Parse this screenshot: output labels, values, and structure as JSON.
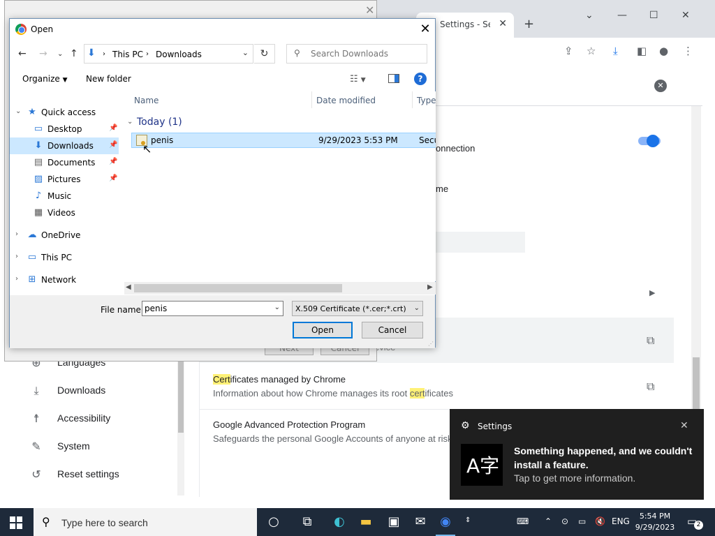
{
  "chrome": {
    "tab_title": "Settings - Sec",
    "rows": {
      "row1_tail": "onnection",
      "row2_tail": "me",
      "wizard_device": "evice",
      "cert_title_hl": "Cert",
      "cert_title_rest": "ificates managed by Chrome",
      "cert_sub_pre": "Information about how Chrome manages its root ",
      "cert_sub_hl": "cert",
      "cert_sub_post": "ificates",
      "gapp_title": "Google Advanced Protection Program",
      "gapp_sub": "Safeguards the personal Google Accounts of anyone at risk"
    },
    "sidebar": [
      {
        "label": "Languages",
        "icon": "globe-icon"
      },
      {
        "label": "Downloads",
        "icon": "download-icon"
      },
      {
        "label": "Accessibility",
        "icon": "accessibility-icon"
      },
      {
        "label": "System",
        "icon": "wrench-icon"
      },
      {
        "label": "Reset settings",
        "icon": "reset-icon"
      }
    ]
  },
  "wizard": {
    "next_label": "Next",
    "cancel_label": "Cancel"
  },
  "dialog": {
    "title": "Open",
    "breadcrumbs": [
      "This PC",
      "Downloads"
    ],
    "search_placeholder": "Search Downloads",
    "organize_label": "Organize",
    "new_folder_label": "New folder",
    "nav_items": [
      {
        "label": "Quick access",
        "icon": "star-icon",
        "pinned": false
      },
      {
        "label": "Desktop",
        "icon": "desktop-icon",
        "pinned": true
      },
      {
        "label": "Downloads",
        "icon": "download-icon",
        "pinned": true,
        "selected": true
      },
      {
        "label": "Documents",
        "icon": "document-icon",
        "pinned": true
      },
      {
        "label": "Pictures",
        "icon": "picture-icon",
        "pinned": true
      },
      {
        "label": "Music",
        "icon": "music-icon",
        "pinned": false
      },
      {
        "label": "Videos",
        "icon": "video-icon",
        "pinned": false
      },
      {
        "label": "OneDrive",
        "icon": "cloud-icon",
        "pinned": false
      },
      {
        "label": "This PC",
        "icon": "computer-icon",
        "pinned": false
      },
      {
        "label": "Network",
        "icon": "network-icon",
        "pinned": false
      }
    ],
    "columns": [
      "Name",
      "Date modified",
      "Type"
    ],
    "group_header": "Today (1)",
    "file": {
      "name": "penis",
      "date_modified": "9/29/2023 5:53 PM",
      "type": "Secu"
    },
    "file_name_label": "File name:",
    "file_name_value": "penis",
    "file_type_selected": "X.509 Certificate (*.cer;*.crt)",
    "open_label": "Open",
    "cancel_label": "Cancel"
  },
  "toast": {
    "app_name": "Settings",
    "heading": "Something happened, and we couldn't install a feature.",
    "subtext": "Tap to get more information."
  },
  "taskbar": {
    "search_placeholder": "Type here to search",
    "language": "ENG",
    "time": "5:54 PM",
    "date": "9/29/2023",
    "notification_count": "2"
  }
}
